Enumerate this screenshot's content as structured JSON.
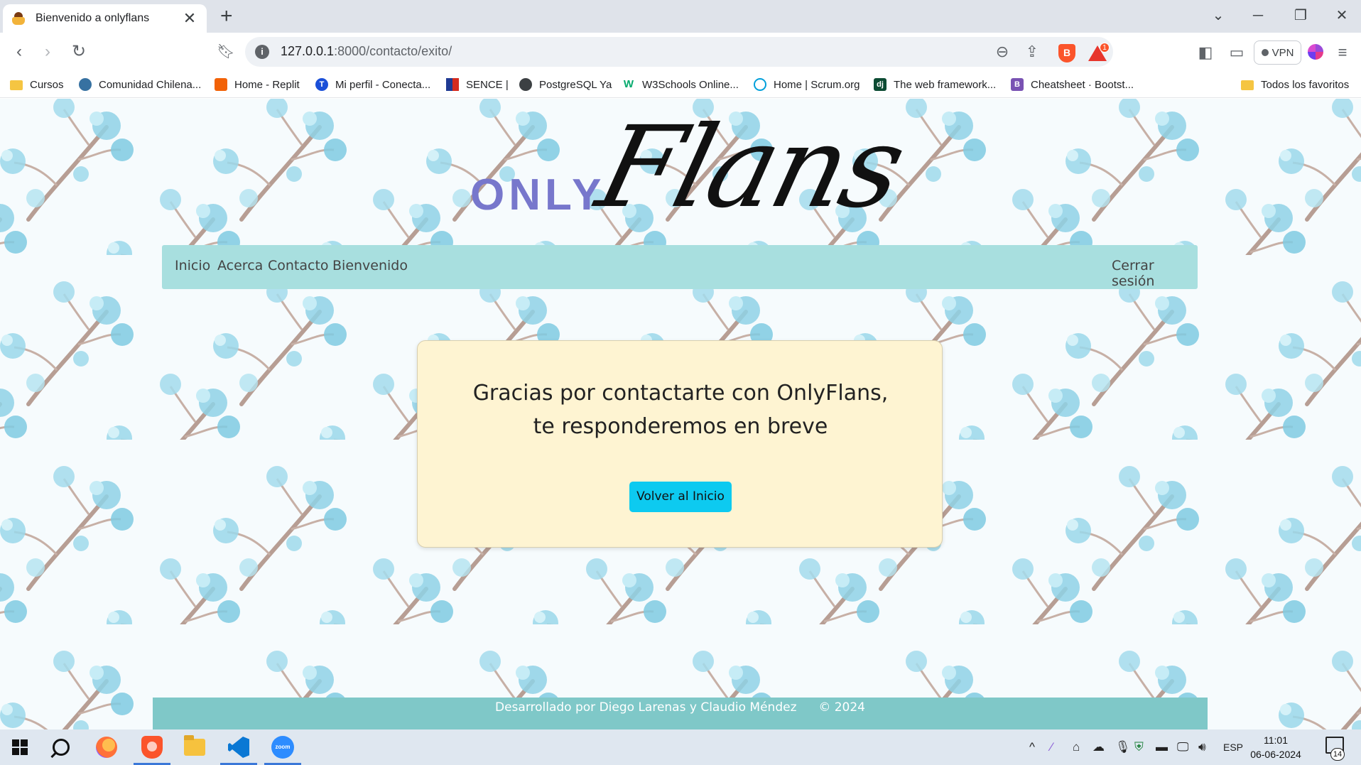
{
  "browser": {
    "tab_title": "Bienvenido a onlyflans",
    "tab_close": "✕",
    "new_tab": "+",
    "url_host": "127.0.0.1",
    "url_path": ":8000/contacto/exito/",
    "vpn_label": "VPN",
    "rewards_badge": "1"
  },
  "bookmarks": [
    {
      "label": "Cursos",
      "icon": "folder-icon",
      "color": "#f5c542"
    },
    {
      "label": "Comunidad Chilena...",
      "icon": "python-icon",
      "color": "#3771a1"
    },
    {
      "label": "Home - Replit",
      "icon": "replit-icon",
      "color": "#f26207"
    },
    {
      "label": "Mi perfil - Conecta...",
      "icon": "talana-icon",
      "color": "#1a4fd8"
    },
    {
      "label": "SENCE |",
      "icon": "sence-icon",
      "color": "#d52b1e"
    },
    {
      "label": "PostgreSQL Ya",
      "icon": "globe-icon",
      "color": "#3c4043"
    },
    {
      "label": "W3Schools Online...",
      "icon": "w3schools-icon",
      "color": "#04aa6d"
    },
    {
      "label": "Home | Scrum.org",
      "icon": "scrum-icon",
      "color": "#009fda"
    },
    {
      "label": "The web framework...",
      "icon": "django-icon",
      "color": "#0c4b33"
    },
    {
      "label": "Cheatsheet · Bootst...",
      "icon": "bootstrap-icon",
      "color": "#7952b3"
    }
  ],
  "bookmarks_all": "Todos los favoritos",
  "site": {
    "logo_only": "ONLY",
    "logo_flans": "Flans",
    "nav": {
      "inicio": "Inicio",
      "acerca": "Acerca",
      "contacto": "Contacto",
      "bienvenido": "Bienvenido",
      "logout": "Cerrar sesión"
    },
    "card": {
      "line1": "Gracias por contactarte con OnlyFlans,",
      "line2": "te responderemos en breve",
      "button": "Volver al Inicio"
    },
    "footer": {
      "credits": "Desarrollado por Diego Larenas y Claudio Méndez",
      "year": "© 2024"
    },
    "colors": {
      "navbar": "#a8dfdf",
      "card_bg": "#fef4d2",
      "button": "#0dcaf0",
      "footer": "#7fc8c8",
      "logo_only": "#7777cc"
    }
  },
  "taskbar": {
    "language": "ESP",
    "time": "11:01",
    "date": "06-06-2024",
    "notifications": "14"
  }
}
